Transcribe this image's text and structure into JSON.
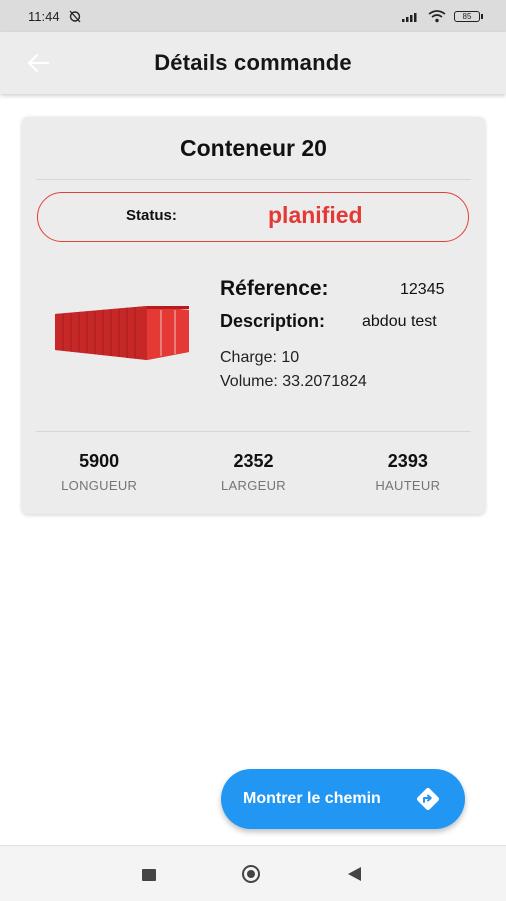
{
  "status_bar": {
    "time": "11:44",
    "battery": "85"
  },
  "app_bar": {
    "title": "Détails commande"
  },
  "card": {
    "title": "Conteneur 20",
    "status_label": "Status:",
    "status_value": "planified",
    "reference_label": "Réference:",
    "reference_value": "12345",
    "description_label": "Description:",
    "description_value": "abdou test",
    "charge": "Charge: 10",
    "volume": "Volume: 33.2071824",
    "dimensions": [
      {
        "value": "5900",
        "label": "LONGUEUR"
      },
      {
        "value": "2352",
        "label": "LARGEUR"
      },
      {
        "value": "2393",
        "label": "HAUTEUR"
      }
    ]
  },
  "fab": {
    "label": "Montrer le chemin"
  },
  "colors": {
    "accent": "#2196f3",
    "status": "#e53935",
    "container": "#e53935"
  }
}
